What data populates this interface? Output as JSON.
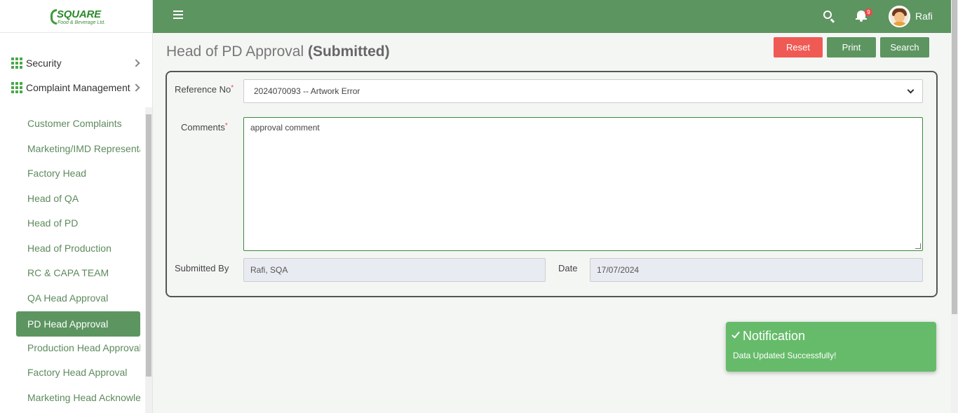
{
  "app": {
    "logo_title": "SQUARE",
    "logo_subtitle": "Food & Beverage Ltd."
  },
  "sidebar": {
    "groups": [
      {
        "label": "Security",
        "icon": "grid-icon"
      },
      {
        "label": "Complaint Management",
        "icon": "grid-icon"
      }
    ],
    "items": [
      {
        "label": "Customer Complaints"
      },
      {
        "label": "Marketing/IMD Representative"
      },
      {
        "label": "Factory Head"
      },
      {
        "label": "Head of QA"
      },
      {
        "label": "Head of PD"
      },
      {
        "label": "Head of Production"
      },
      {
        "label": "RC & CAPA TEAM"
      },
      {
        "label": "QA Head Approval"
      },
      {
        "label": "PD Head Approval",
        "active": true
      },
      {
        "label": "Production Head Approval"
      },
      {
        "label": "Factory Head Approval"
      },
      {
        "label": "Marketing Head Acknowledgement"
      }
    ]
  },
  "topbar": {
    "notification_count": "9",
    "username": "Rafi"
  },
  "page": {
    "title": "Head of PD Approval",
    "status": "(Submitted)"
  },
  "buttons": {
    "reset": "Reset",
    "print": "Print",
    "search": "Search"
  },
  "form": {
    "reference_label": "Reference No",
    "reference_value": "2024070093 -- Artwork Error",
    "comments_label": "Comments",
    "comments_value": "approval comment",
    "required_mark": "*",
    "submitted_by_label": "Submitted By",
    "submitted_by_value": "Rafi, SQA",
    "date_label": "Date",
    "date_value": "17/07/2024"
  },
  "notification": {
    "title": "Notification",
    "message": "Data Updated Successfully!"
  },
  "colors": {
    "brand_green": "#5c9560",
    "reset_red": "#f05a55",
    "toast_green": "#66bb6a"
  }
}
